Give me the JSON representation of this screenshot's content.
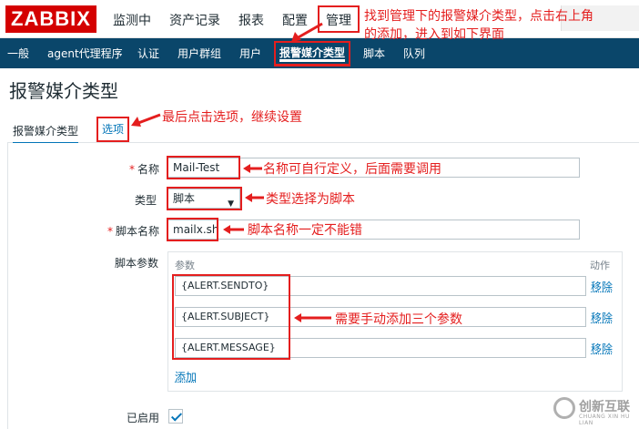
{
  "brand": {
    "logo_text": "ZABBIX",
    "accent_red": "#d40000",
    "nav_blue": "#0a466a",
    "link_blue": "#0275b8",
    "annotation_red": "#e41e1e"
  },
  "top_menu": [
    {
      "label": "监测中"
    },
    {
      "label": "资产记录"
    },
    {
      "label": "报表"
    },
    {
      "label": "配置"
    },
    {
      "label": "管理",
      "active": true
    }
  ],
  "sub_menu": [
    {
      "label": "一般"
    },
    {
      "label": "agent代理程序"
    },
    {
      "label": "认证"
    },
    {
      "label": "用户群组"
    },
    {
      "label": "用户"
    },
    {
      "label": "报警媒介类型",
      "active": true
    },
    {
      "label": "脚本"
    },
    {
      "label": "队列"
    }
  ],
  "page_title": "报警媒介类型",
  "tabs": [
    {
      "label": "报警媒介类型",
      "active": true
    },
    {
      "label": "选项"
    }
  ],
  "form": {
    "name_label": "名称",
    "name_value": "Mail-Test",
    "type_label": "类型",
    "type_value": "脚本",
    "script_name_label": "脚本名称",
    "script_name_value": "mailx.sh",
    "script_params_label": "脚本参数",
    "params_header": "参数",
    "action_header": "动作",
    "params": [
      {
        "value": "{ALERT.SENDTO}",
        "remove": "移除"
      },
      {
        "value": "{ALERT.SUBJECT}",
        "remove": "移除"
      },
      {
        "value": "{ALERT.MESSAGE}",
        "remove": "移除"
      }
    ],
    "add_link": "添加",
    "enabled_label": "已启用",
    "enabled_checked": true
  },
  "annotations": {
    "admin_note_line1": "找到管理下的报警媒介类型，点击右上角",
    "admin_note_line2": "的添加，进入到如下界面",
    "options_note": "最后点击选项，继续设置",
    "name_note": "名称可自行定义，后面需要调用",
    "type_note": "类型选择为脚本",
    "script_note": "脚本名称一定不能错",
    "params_note": "需要手动添加三个参数"
  },
  "watermark": {
    "text": "创新互联",
    "sub": "CHUANG XIN HU LIAN"
  }
}
